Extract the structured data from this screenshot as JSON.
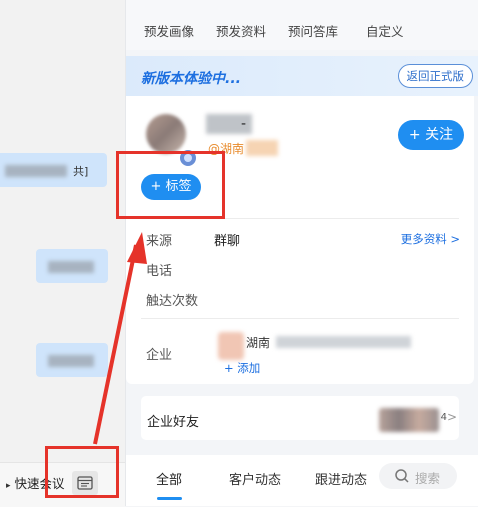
{
  "left_pane": {
    "bubble_text_1": "共]",
    "quick_meeting_label": "快速会议",
    "quick_meeting_icon": "video-icon",
    "panel_button_icon": "panel-icon"
  },
  "top_tabs": [
    "预发画像",
    "预发资料",
    "预问答库",
    "自定义"
  ],
  "banner": {
    "title": "新版本体验中...",
    "back_button": "返回正式版"
  },
  "profile": {
    "name_suffix": "-",
    "region": "@湖南",
    "follow_button": "+ 关注",
    "label_button": "+ 标签",
    "rows": {
      "source_label": "来源",
      "source_value": "群聊",
      "more_link": "更多资料 >",
      "phone_label": "电话",
      "touch_label": "触达次数",
      "company_label": "企业",
      "company_name": "湖南",
      "add_link": "+ 添加"
    }
  },
  "friends": {
    "label": "企业好友",
    "count": "4",
    "chevron": ">"
  },
  "bottom_tabs": {
    "all": "全部",
    "customer": "客户动态",
    "followup": "跟进动态",
    "search_placeholder": "搜索"
  },
  "colors": {
    "accent": "#1f8ef1",
    "annotation": "#e5332a",
    "region": "#e88a2a"
  }
}
